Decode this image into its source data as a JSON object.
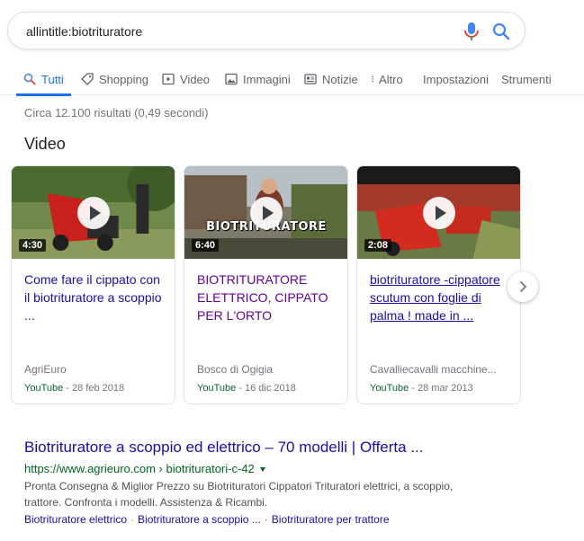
{
  "search": {
    "query": "allintitle:biotrituratore"
  },
  "tabs": [
    {
      "label": "Tutti",
      "icon": "search-icon"
    },
    {
      "label": "Shopping",
      "icon": "tag-icon"
    },
    {
      "label": "Video",
      "icon": "play-box-icon"
    },
    {
      "label": "Immagini",
      "icon": "image-icon"
    },
    {
      "label": "Notizie",
      "icon": "news-icon"
    },
    {
      "label": "Altro",
      "icon": "more-vert-icon"
    },
    {
      "label": "Impostazioni"
    },
    {
      "label": "Strumenti"
    }
  ],
  "stats": "Circa 12.100 risultati (0,49 secondi)",
  "video_section": {
    "heading": "Video"
  },
  "videos": [
    {
      "duration": "4:30",
      "title": "Come fare il cippato con il biotrituratore a scoppio ...",
      "channel": "AgriEuro",
      "source": "YouTube",
      "date": " - 28 feb 2018"
    },
    {
      "duration": "6:40",
      "overlay_text": "BIOTRITURATORE",
      "title": "BIOTRITURATORE ELETTRICO, CIPPATO PER L'ORTO",
      "channel": "Bosco di Ogigia",
      "source": "YouTube",
      "date": " - 16 dic 2018"
    },
    {
      "duration": "2:08",
      "title": "biotrituratore -cippatore scutum con foglie di palma ! made in ...",
      "channel": "Cavalliecavalli macchine...",
      "source": "YouTube",
      "date": " - 28 mar 2013"
    }
  ],
  "result": {
    "title": "Biotrituratore a scoppio ed elettrico – 70 modelli | Offerta ...",
    "url": "https://www.agrieuro.com › biotrituratori-c-42",
    "snippet": "Pronta Consegna & Miglior Prezzo su Biotrituratori Cippatori Trituratori elettrici, a scoppio, trattore. Confronta i modelli. Assistenza & Ricambi.",
    "sitelinks": [
      "Biotrituratore elettrico",
      "Biotrituratore a scoppio ...",
      "Biotrituratore per trattore"
    ],
    "sitelink_separator": "·"
  },
  "colors": {
    "link": "#1a0dab",
    "visited": "#660099",
    "url_green": "#006621",
    "accent_blue": "#1a73e8",
    "mic_red": "#ea4335"
  }
}
